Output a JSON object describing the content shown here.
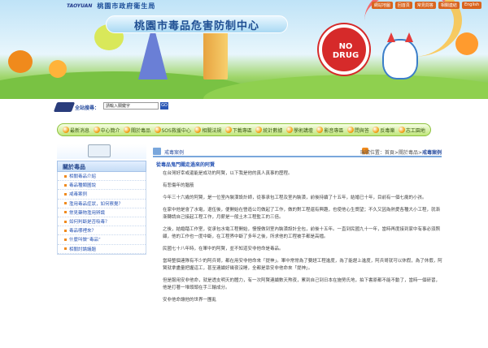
{
  "header": {
    "brand": "TAOYUAN",
    "org": "桃園市政府衛生局",
    "site_title": "桃園市毒品危害防制中心",
    "badge": "NO DRUG",
    "top_links": [
      "網站地圖",
      "回首頁",
      "常見問答",
      "相關連結",
      "English"
    ]
  },
  "search": {
    "label": "全站搜尋：",
    "placeholder": "請輸入關鍵字",
    "go": "GO"
  },
  "nav": {
    "items": [
      "最新消息",
      "中心簡介",
      "關於毒品",
      "SOS救援中心",
      "相關法規",
      "下載專區",
      "統計數據",
      "學術講壇",
      "影音專區",
      "問與答",
      "反毒樂",
      "志工園地"
    ]
  },
  "sidebar": {
    "title": "關於毒品",
    "items": [
      "相關毒品介紹",
      "毒品種類圖說",
      "戒毒案例",
      "濫用毒品症狀，如何察覺？",
      "常見藥物濫用辨識",
      "如何判斷是否吸毒？",
      "毒品哪裡來？",
      "什麼叫做“毒品”",
      "相關討論議題"
    ]
  },
  "breadcrumb": {
    "section": "戒毒案例",
    "label": "瑞號位置：",
    "path": "首頁>關於毒品>",
    "current": "戒毒案例"
  },
  "article": {
    "title": "從毒品鬼門關走過來的阿賢",
    "paragraphs": [
      "在台灣好幸或還能是成功的阿賢，以下我是他的真人真事的歷程。",
      "有悲傷年的腦筋",
      "今年三十六歲的阿賢，是一位室內裝潢設計師，從事承包工程及室內裝潢，前後持續了十五年，結婚已十年，目前有一個七歲的小孩。",
      "在家中他是會了水電，退伍後，便開始在營造公司做起了工作，做的對工程還有興趣，也使他心生嚮望；不久又因為熱愛各種大小工程，就漸漸轉請自己接起工程工作，月薪是一般土木工程監工的三倍。",
      "之後，結婚踏工作室，從承包水電工程開始，慢慢做到室內裝潢設計全包，前後十五年。一直到民國九十一年，當時再度接到家中有事必須照顧，他的工作也一度中斷，在工程界中斷了多年之後，所求他的工程被手都是高檔。",
      "民國七十八年時，在軍中的阿賢，並不知道安非他命是毒品。",
      "當時整個連隊有不少的阿兵哥，都在用安非他命來「提神」。軍中常常為了要趕工程進度，為了能趕上進度，阿兵哥就可以休假，為了休假，阿賢就拿盡量把握這工，甚至連續好幾夜沒睡，全都是靠安非他命來「提神」。",
      "但是服用安非他命，就是透支明天的體力，有一次阿賢連續數天熬夜，累到自己到日本在施勞氏地，拍下書原都不能不動了，當時一個研習，他是打著一堆頭頭在手三輪成分。",
      "安非他命讓他的世界一團亂"
    ]
  }
}
